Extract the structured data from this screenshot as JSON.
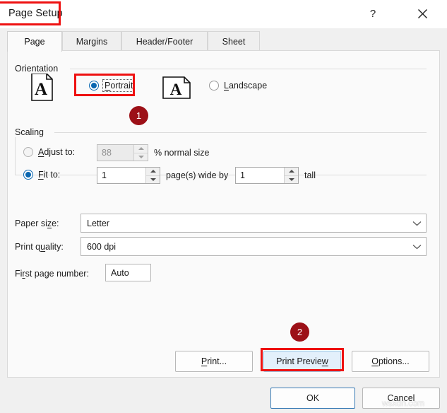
{
  "window": {
    "title": "Page Setup",
    "help_icon": "?",
    "close_icon": "close-icon"
  },
  "tabs": [
    {
      "label": "Page",
      "active": true
    },
    {
      "label": "Margins",
      "active": false
    },
    {
      "label": "Header/Footer",
      "active": false
    },
    {
      "label": "Sheet",
      "active": false
    }
  ],
  "orientation": {
    "group_label": "Orientation",
    "portrait": {
      "label": "Portrait",
      "accelerator": "P",
      "selected": true,
      "focused": true,
      "icon": "portrait-page-icon"
    },
    "landscape": {
      "label": "Landscape",
      "accelerator": "L",
      "selected": false,
      "icon": "landscape-page-icon"
    }
  },
  "scaling": {
    "group_label": "Scaling",
    "adjust_to": {
      "label": "Adjust to:",
      "value": "88",
      "suffix": "% normal size",
      "selected": false,
      "disabled": true
    },
    "fit_to": {
      "label": "Fit to:",
      "wide_value": "1",
      "middle_text": "page(s) wide by",
      "tall_value": "1",
      "tall_text": "tall",
      "selected": true
    }
  },
  "fields": {
    "paper_size": {
      "label": "Paper size:",
      "value": "Letter"
    },
    "print_quality": {
      "label": "Print quality:",
      "value": "600 dpi"
    },
    "first_page_number": {
      "label": "First page number:",
      "value": "Auto"
    }
  },
  "panel_buttons": {
    "print": "Print...",
    "print_preview": "Print Preview",
    "options": "Options..."
  },
  "footer_buttons": {
    "ok": "OK",
    "cancel": "Cancel"
  },
  "annotations": {
    "badge_1": "1",
    "badge_2": "2",
    "box_color": "#ee1111",
    "badge_color": "#9c1017"
  },
  "watermark": "wsxdn.com"
}
